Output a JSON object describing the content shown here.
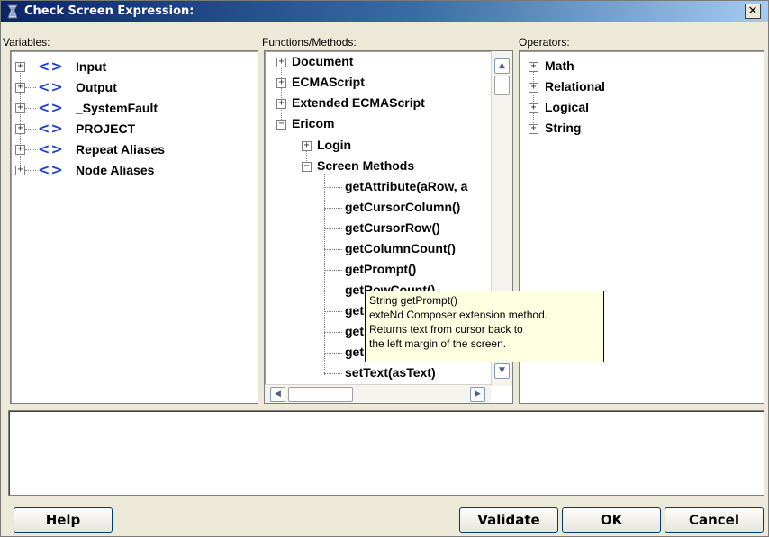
{
  "window": {
    "title": "Check Screen Expression:",
    "close_label": "✕"
  },
  "variables": {
    "label": "Variables:",
    "icon_text": "<>",
    "items": [
      "Input",
      "Output",
      "_SystemFault",
      "PROJECT",
      "Repeat Aliases",
      "Node Aliases"
    ]
  },
  "functions": {
    "label": "Functions/Methods:",
    "top_items": [
      "Document",
      "ECMAScript",
      "Extended ECMAScript",
      "Ericom"
    ],
    "ericom_children": [
      "Login",
      "Screen Methods"
    ],
    "screen_methods": [
      "getAttribute(aRow, a",
      "getCursorColumn()",
      "getCursorRow()",
      "getColumnCount()",
      "getPrompt()",
      "getRowCount()",
      "get",
      "get",
      "get",
      "setText(asText)"
    ]
  },
  "operators": {
    "label": "Operators:",
    "items": [
      "Math",
      "Relational",
      "Logical",
      "String"
    ]
  },
  "tooltip": {
    "lines": [
      "String getPrompt()",
      "exteNd Composer extension method.",
      "Returns text from cursor back to",
      "the left margin of the screen."
    ]
  },
  "expression": {
    "value": ""
  },
  "buttons": {
    "help": "Help",
    "validate": "Validate",
    "ok": "OK",
    "cancel": "Cancel"
  },
  "scroll_glyphs": {
    "up": "▲",
    "down": "▼",
    "left": "◀",
    "right": "▶"
  }
}
